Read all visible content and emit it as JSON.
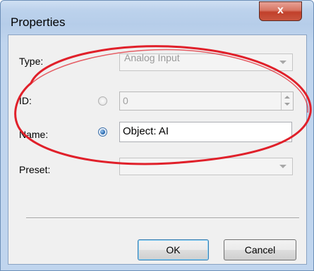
{
  "window": {
    "title": "Properties",
    "close_glyph": "x"
  },
  "form": {
    "type_label": "Type:",
    "type_value": "Analog Input",
    "id_label": "ID:",
    "id_value": "0",
    "name_label": "Name:",
    "name_value": "Object: AI",
    "preset_label": "Preset:",
    "preset_value": ""
  },
  "buttons": {
    "ok": "OK",
    "cancel": "Cancel"
  },
  "icons": {
    "close": "close-icon",
    "dropdown": "chevron-down-icon",
    "spinner_up": "spin-up-icon",
    "spinner_down": "spin-down-icon"
  },
  "colors": {
    "annotation": "#e0202a",
    "close_button": "#c9553f",
    "titlebar": "#bcd2ec"
  }
}
